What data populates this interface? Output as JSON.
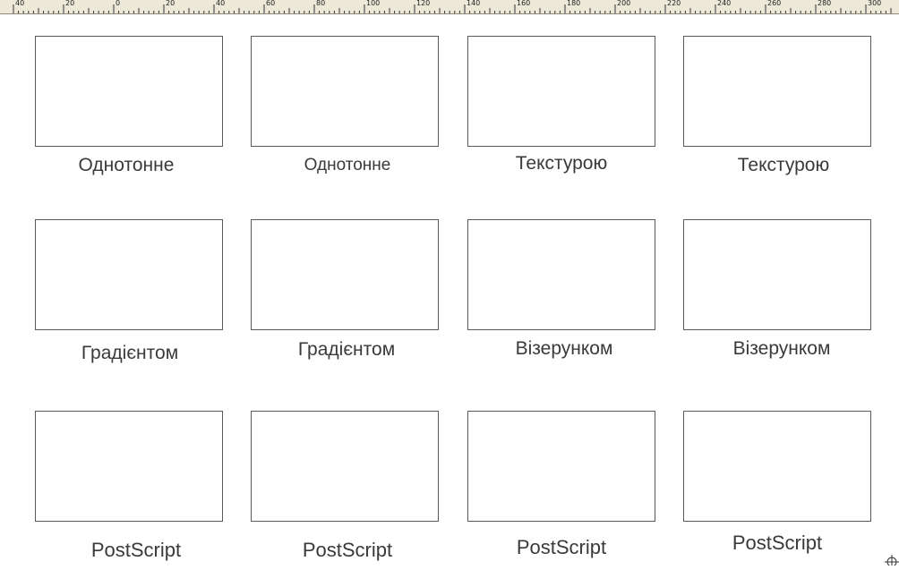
{
  "ruler": {
    "labels": [
      "40",
      "20",
      "0",
      "20",
      "40",
      "60",
      "80",
      "100",
      "120",
      "140",
      "160",
      "180",
      "200",
      "220",
      "240",
      "260",
      "280",
      "300"
    ]
  },
  "tiles": [
    {
      "label": "Однотонне"
    },
    {
      "label": "Однотонне"
    },
    {
      "label": "Текстурою"
    },
    {
      "label": "Текстурою"
    },
    {
      "label": "Градієнтом"
    },
    {
      "label": "Градієнтом"
    },
    {
      "label": "Візерунком"
    },
    {
      "label": "Візерунком"
    },
    {
      "label": "PostScript"
    },
    {
      "label": "PostScript"
    },
    {
      "label": "PostScript"
    },
    {
      "label": "PostScript"
    }
  ],
  "icons": {
    "corner": "crosshair-target-icon"
  }
}
